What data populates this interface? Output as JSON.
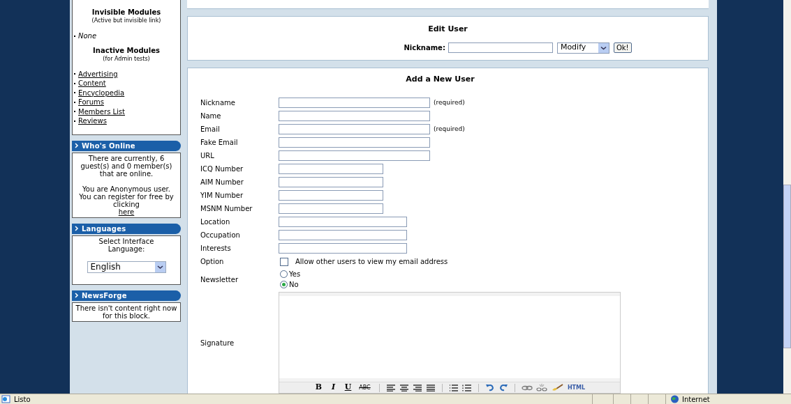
{
  "sidebar": {
    "modules": [
      {
        "title": "Invisible Modules",
        "subtitle": "(Active but invisible link)",
        "items": [
          {
            "label": "None",
            "kind": "plain"
          }
        ]
      },
      {
        "title": "Inactive Modules",
        "subtitle": "(for Admin tests)",
        "items": [
          {
            "label": "Advertising",
            "kind": "link"
          },
          {
            "label": "Content",
            "kind": "link"
          },
          {
            "label": "Encyclopedia",
            "kind": "link"
          },
          {
            "label": "Forums",
            "kind": "link"
          },
          {
            "label": "Members List",
            "kind": "link"
          },
          {
            "label": "Reviews",
            "kind": "link"
          }
        ]
      }
    ],
    "blocks": [
      {
        "title": "Who's Online",
        "kind": "online",
        "text": "There are currently, 6 guest(s) and 0 member(s) that are online.",
        "text2": "You are Anonymous user. You can register for free by clicking",
        "link": "here"
      },
      {
        "title": "Languages",
        "kind": "language",
        "text": "Select Interface Language:",
        "value": "English"
      },
      {
        "title": "NewsForge",
        "kind": "text",
        "text": "There isn't content right now for this block."
      }
    ]
  },
  "edit_user": {
    "title": "Edit User",
    "label": "Nickname:",
    "action": "Modify",
    "button": "Ok!"
  },
  "add_user": {
    "title": "Add a New User",
    "fields": [
      {
        "label": "Nickname",
        "kind": "long",
        "note": "(required)"
      },
      {
        "label": "Name",
        "kind": "long"
      },
      {
        "label": "Email",
        "kind": "long",
        "note": "(required)"
      },
      {
        "label": "Fake Email",
        "kind": "long"
      },
      {
        "label": "URL",
        "kind": "long"
      },
      {
        "label": "ICQ Number",
        "kind": "short"
      },
      {
        "label": "AIM Number",
        "kind": "short"
      },
      {
        "label": "YIM Number",
        "kind": "short"
      },
      {
        "label": "MSNM Number",
        "kind": "short"
      },
      {
        "label": "Location",
        "kind": "mid"
      },
      {
        "label": "Occupation",
        "kind": "mid"
      },
      {
        "label": "Interests",
        "kind": "mid"
      },
      {
        "label": "Option",
        "kind": "checkbox",
        "text": "Allow other users to view my email address",
        "checked": false
      },
      {
        "label": "Newsletter",
        "kind": "radio",
        "options": [
          {
            "label": "Yes",
            "selected": false
          },
          {
            "label": "No",
            "selected": true
          }
        ]
      },
      {
        "label": "Signature",
        "kind": "editor",
        "toolbar": [
          {
            "kind": "bold",
            "label": "B"
          },
          {
            "kind": "italic",
            "label": "I"
          },
          {
            "kind": "underline",
            "label": "U"
          },
          {
            "kind": "strike",
            "label": "ABC"
          },
          {
            "kind": "sep"
          },
          {
            "kind": "left"
          },
          {
            "kind": "center"
          },
          {
            "kind": "right"
          },
          {
            "kind": "justify"
          },
          {
            "kind": "sep"
          },
          {
            "kind": "bullets"
          },
          {
            "kind": "numbers"
          },
          {
            "kind": "sep"
          },
          {
            "kind": "undo"
          },
          {
            "kind": "redo"
          },
          {
            "kind": "sep"
          },
          {
            "kind": "link"
          },
          {
            "kind": "unlink"
          },
          {
            "kind": "brush"
          },
          {
            "kind": "html",
            "label": "HTML"
          }
        ]
      }
    ]
  },
  "status_bar": {
    "text": "Listo",
    "zone": "Internet"
  }
}
